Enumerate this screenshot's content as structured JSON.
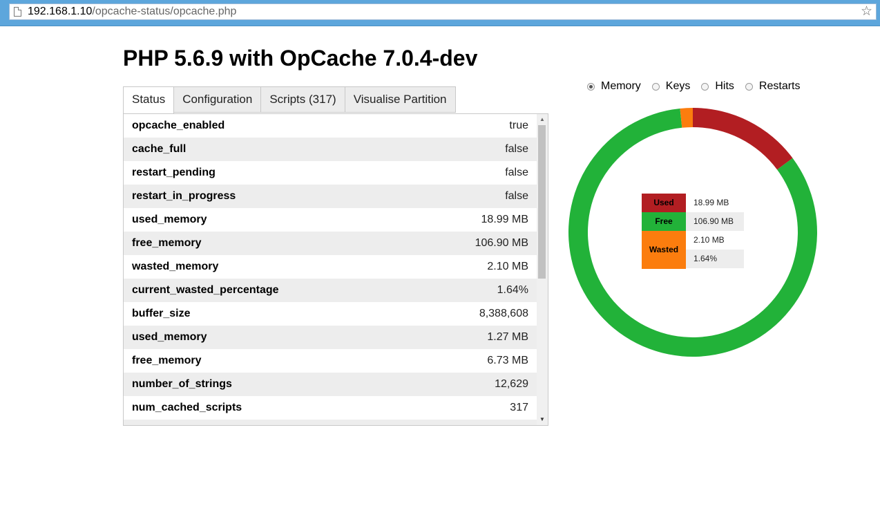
{
  "browser": {
    "url_host": "192.168.1.10",
    "url_path": "/opcache-status/opcache.php",
    "bookmark_icon": "star-icon"
  },
  "page": {
    "title": "PHP 5.6.9 with OpCache 7.0.4-dev"
  },
  "tabs": [
    {
      "label": "Status",
      "active": true
    },
    {
      "label": "Configuration",
      "active": false
    },
    {
      "label": "Scripts (317)",
      "active": false
    },
    {
      "label": "Visualise Partition",
      "active": false
    }
  ],
  "status_rows": [
    {
      "key": "opcache_enabled",
      "value": "true"
    },
    {
      "key": "cache_full",
      "value": "false"
    },
    {
      "key": "restart_pending",
      "value": "false"
    },
    {
      "key": "restart_in_progress",
      "value": "false"
    },
    {
      "key": "used_memory",
      "value": "18.99 MB"
    },
    {
      "key": "free_memory",
      "value": "106.90 MB"
    },
    {
      "key": "wasted_memory",
      "value": "2.10 MB"
    },
    {
      "key": "current_wasted_percentage",
      "value": "1.64%"
    },
    {
      "key": "buffer_size",
      "value": "8,388,608"
    },
    {
      "key": "used_memory",
      "value": "1.27 MB"
    },
    {
      "key": "free_memory",
      "value": "6.73 MB"
    },
    {
      "key": "number_of_strings",
      "value": "12,629"
    },
    {
      "key": "num_cached_scripts",
      "value": "317"
    }
  ],
  "chart_selector": {
    "options": [
      {
        "label": "Memory",
        "checked": true
      },
      {
        "label": "Keys",
        "checked": false
      },
      {
        "label": "Hits",
        "checked": false
      },
      {
        "label": "Restarts",
        "checked": false
      }
    ]
  },
  "chart_data": {
    "type": "pie",
    "style": "donut",
    "categories": [
      "Used",
      "Free",
      "Wasted"
    ],
    "values": [
      18.99,
      106.9,
      2.1
    ],
    "colors": [
      "#b21e22",
      "#22b239",
      "#fb7d0e"
    ],
    "legend": [
      {
        "label": "Used",
        "value": "18.99 MB",
        "color": "#b21e22"
      },
      {
        "label": "Free",
        "value": "106.90 MB",
        "color": "#22b239"
      },
      {
        "label": "Wasted",
        "value": "2.10 MB",
        "color": "#fb7d0e",
        "extra": "1.64%"
      }
    ]
  }
}
